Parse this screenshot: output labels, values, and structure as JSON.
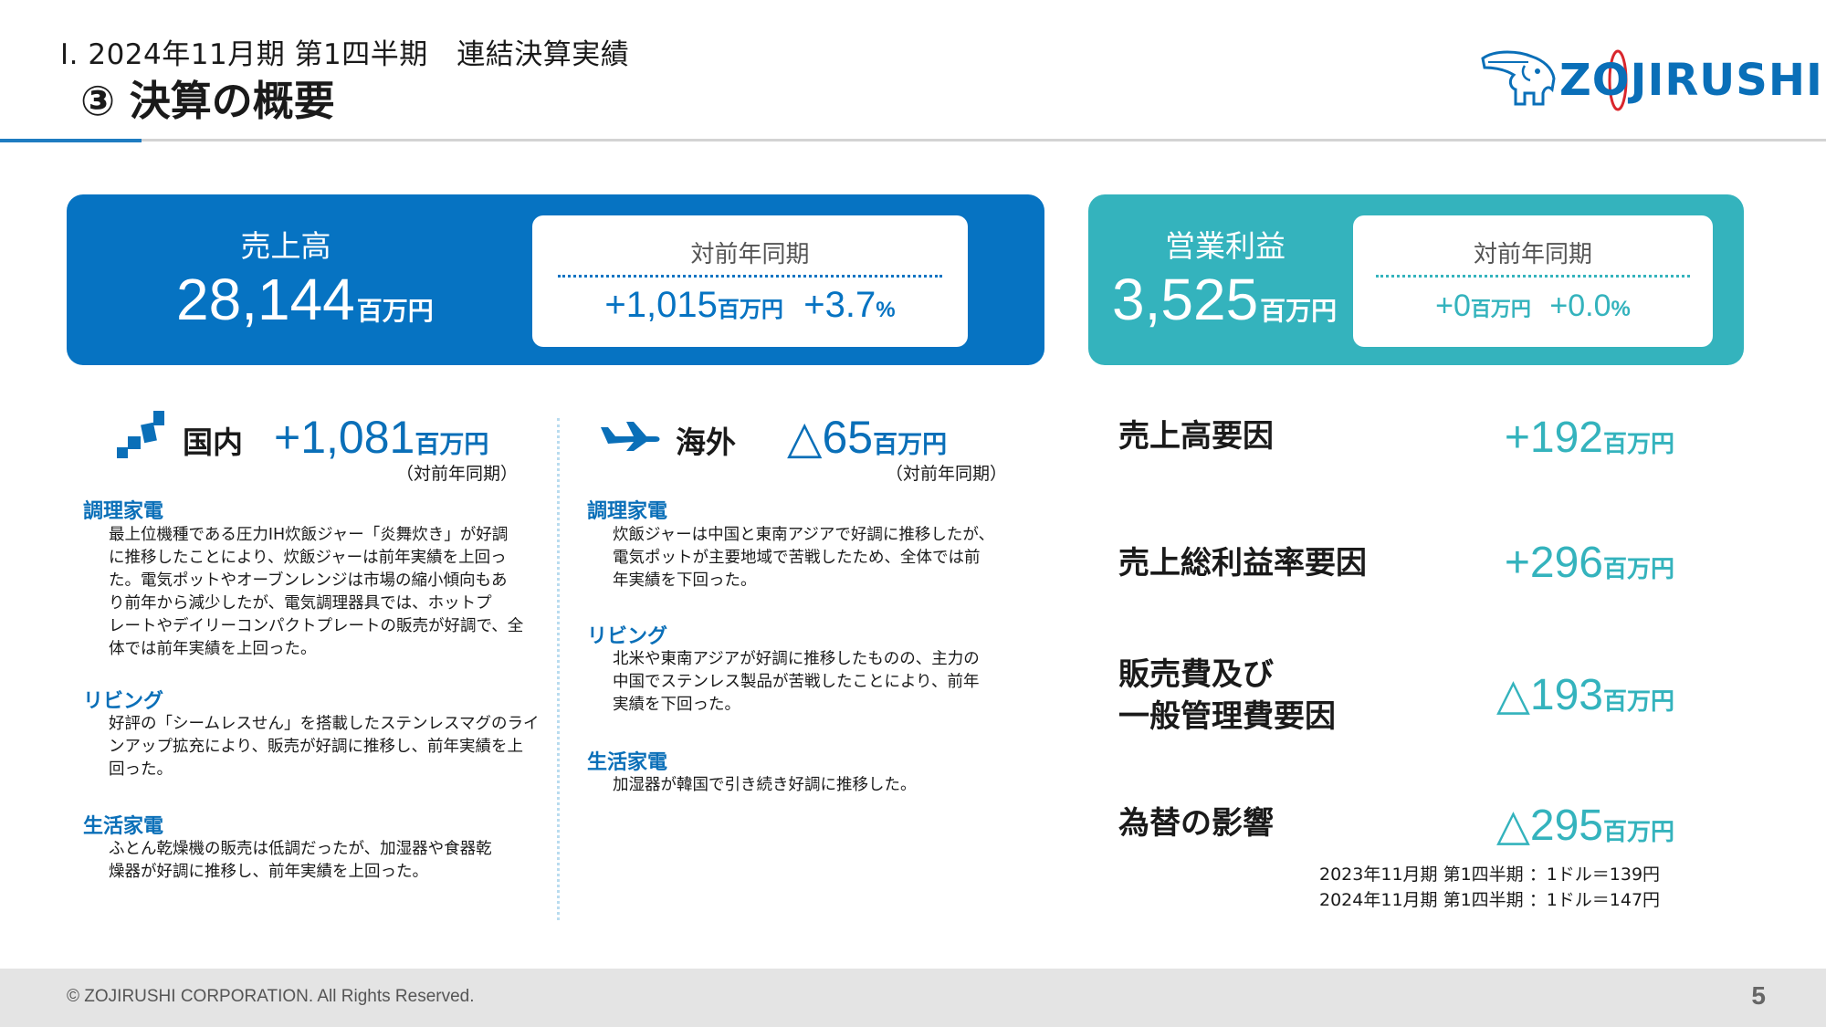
{
  "header": {
    "subtitle": "Ⅰ. 2024年11月期 第1四半期　連結決算実績",
    "title": "③ 決算の概要"
  },
  "logo": {
    "text": "ZOJIRUSHI",
    "icon": "elephant-logo-icon"
  },
  "sales": {
    "label": "売上高",
    "value": "28,144",
    "unit": "百万円",
    "yoy_title": "対前年同期",
    "yoy_value": "+1,015",
    "yoy_unit": "百万円",
    "yoy_pct": "+3.7",
    "yoy_pct_unit": "%"
  },
  "operating_profit": {
    "label": "営業利益",
    "value": "3,525",
    "unit": "百万円",
    "yoy_title": "対前年同期",
    "yoy_value": "+0",
    "yoy_unit": "百万円",
    "yoy_pct": "+0.0",
    "yoy_pct_unit": "%"
  },
  "domestic": {
    "icon": "ascending-steps-icon",
    "name": "国内",
    "value": "+1,081",
    "unit": "百万円",
    "note": "（対前年同期）",
    "categories": [
      {
        "title": "調理家電",
        "body": [
          "最上位機種である圧力IH炊飯ジャー「炎舞炊き」が好調",
          "に推移したことにより、炊飯ジャーは前年実績を上回っ",
          "た。電気ポットやオーブンレンジは市場の縮小傾向もあ",
          "り前年から減少したが、電気調理器具では、ホットプ",
          "レートやデイリーコンパクトプレートの販売が好調で、全",
          "体では前年実績を上回った。"
        ]
      },
      {
        "title": "リビング",
        "body": [
          "好評の「シームレスせん」を搭載したステンレスマグのライ",
          "ンアップ拡充により、販売が好調に推移し、前年実績を上",
          "回った。"
        ]
      },
      {
        "title": "生活家電",
        "body": [
          "ふとん乾燥機の販売は低調だったが、加湿器や食器乾",
          "燥器が好調に推移し、前年実績を上回った。"
        ]
      }
    ]
  },
  "overseas": {
    "icon": "airplane-icon",
    "name": "海外",
    "value": "△65",
    "unit": "百万円",
    "note": "（対前年同期）",
    "categories": [
      {
        "title": "調理家電",
        "body": [
          "炊飯ジャーは中国と東南アジアで好調に推移したが、",
          "電気ポットが主要地域で苦戦したため、全体では前",
          "年実績を下回った。"
        ]
      },
      {
        "title": "リビング",
        "body": [
          "北米や東南アジアが好調に推移したものの、主力の",
          "中国でステンレス製品が苦戦したことにより、前年",
          "実績を下回った。"
        ]
      },
      {
        "title": "生活家電",
        "body": [
          "加湿器が韓国で引き続き好調に推移した。"
        ]
      }
    ]
  },
  "factors": [
    {
      "label": [
        "売上高要因"
      ],
      "value": "+192",
      "unit": "百万円"
    },
    {
      "label": [
        "売上総利益率要因"
      ],
      "value": "+296",
      "unit": "百万円"
    },
    {
      "label": [
        "販売費及び",
        "一般管理費要因"
      ],
      "value": "△193",
      "unit": "百万円"
    },
    {
      "label": [
        "為替の影響"
      ],
      "value": "△295",
      "unit": "百万円"
    }
  ],
  "fx_notes": [
    "2023年11月期 第1四半期 ：1ドル＝139円",
    "2024年11月期 第1四半期 ：1ドル＝147円"
  ],
  "footer": {
    "copyright": "© ZOJIRUSHI CORPORATION. All Rights Reserved.",
    "page": "5"
  },
  "colors": {
    "blue": "#0673c2",
    "teal": "#34b3bd",
    "text_blue": "#0a6fb8",
    "logo_red": "#d9262c"
  }
}
